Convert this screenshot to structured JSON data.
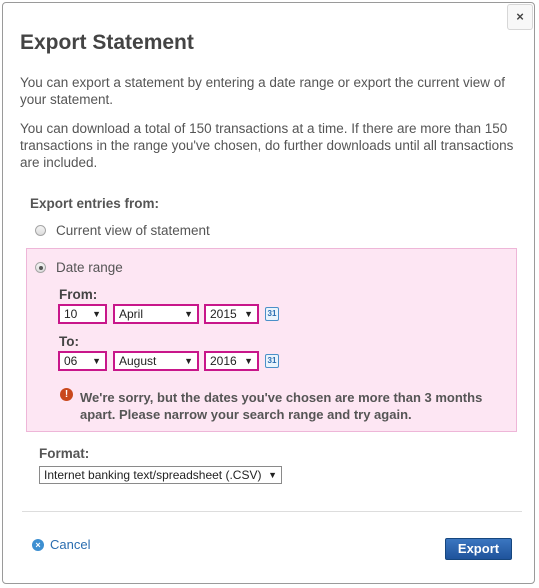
{
  "dialog": {
    "title": "Export Statement",
    "close_glyph": "×",
    "intro": "You can export a statement by entering a date range or export the current view of your statement.",
    "limit_note": "You can download a total of 150 transactions at a time. If there are more than 150 transactions in the range you've chosen, do further downloads until all transactions are included."
  },
  "export_from": {
    "label": "Export entries from:",
    "options": [
      {
        "label": "Current view of statement",
        "selected": false
      },
      {
        "label": "Date range",
        "selected": true
      }
    ]
  },
  "date_range": {
    "from_label": "From:",
    "to_label": "To:",
    "from": {
      "day": "10",
      "month": "April",
      "year": "2015"
    },
    "to": {
      "day": "06",
      "month": "August",
      "year": "2016"
    },
    "calendar_glyph": "31",
    "error_glyph": "!",
    "error": "We're sorry, but the dates you've chosen are more than 3 months apart. Please narrow your search range and try again."
  },
  "format": {
    "label": "Format:",
    "selected": "Internet banking text/spreadsheet (.CSV)"
  },
  "footer": {
    "cancel_label": "Cancel",
    "cancel_glyph": "×",
    "export_label": "Export"
  },
  "colors": {
    "error_highlight_border": "#c8168a",
    "error_panel_bg": "#fde6f3",
    "primary_button": "#2a5fa8",
    "link": "#2a6db0",
    "error_icon": "#c9481c"
  }
}
